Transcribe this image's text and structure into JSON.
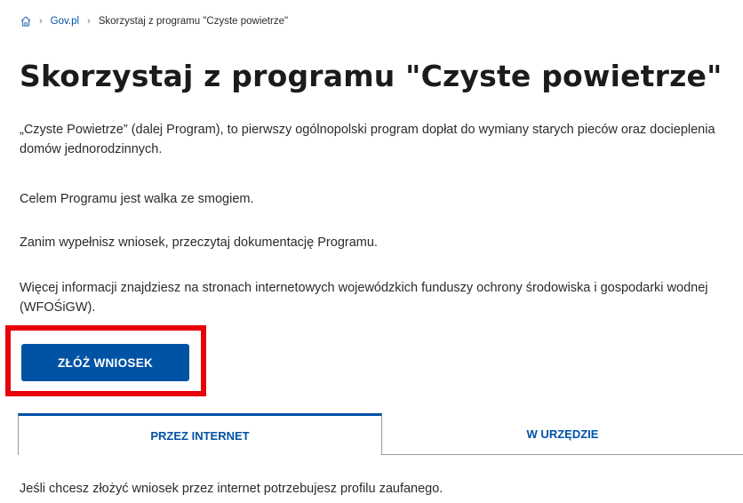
{
  "breadcrumb": {
    "home_icon": "home-icon",
    "items": [
      "Gov.pl",
      "Skorzystaj z programu \"Czyste powietrze\""
    ],
    "separator": "›"
  },
  "page": {
    "title": "Skorzystaj z programu \"Czyste powietrze\"",
    "paragraphs": [
      "„Czyste Powietrze” (dalej Program), to pierwszy ogólnopolski program dopłat do wymiany starych pieców oraz docieplenia domów jednorodzinnych.",
      "Celem Programu jest walka ze smogiem.",
      "Zanim wypełnisz wniosek, przeczytaj dokumentację Programu.",
      "Więcej informacji znajdziesz na stronach internetowych wojewódzkich funduszy ochrony środowiska i gospodarki wodnej (WFOŚiGW)."
    ],
    "apply_button": "ZŁÓŻ WNIOSEK",
    "tabs": [
      "PRZEZ INTERNET",
      "W URZĘDZIE"
    ],
    "tab_content": "Jeśli chcesz złożyć wniosek przez internet potrzebujesz profilu zaufanego."
  },
  "colors": {
    "accent": "#0052a5",
    "highlight": "#e8000b"
  }
}
